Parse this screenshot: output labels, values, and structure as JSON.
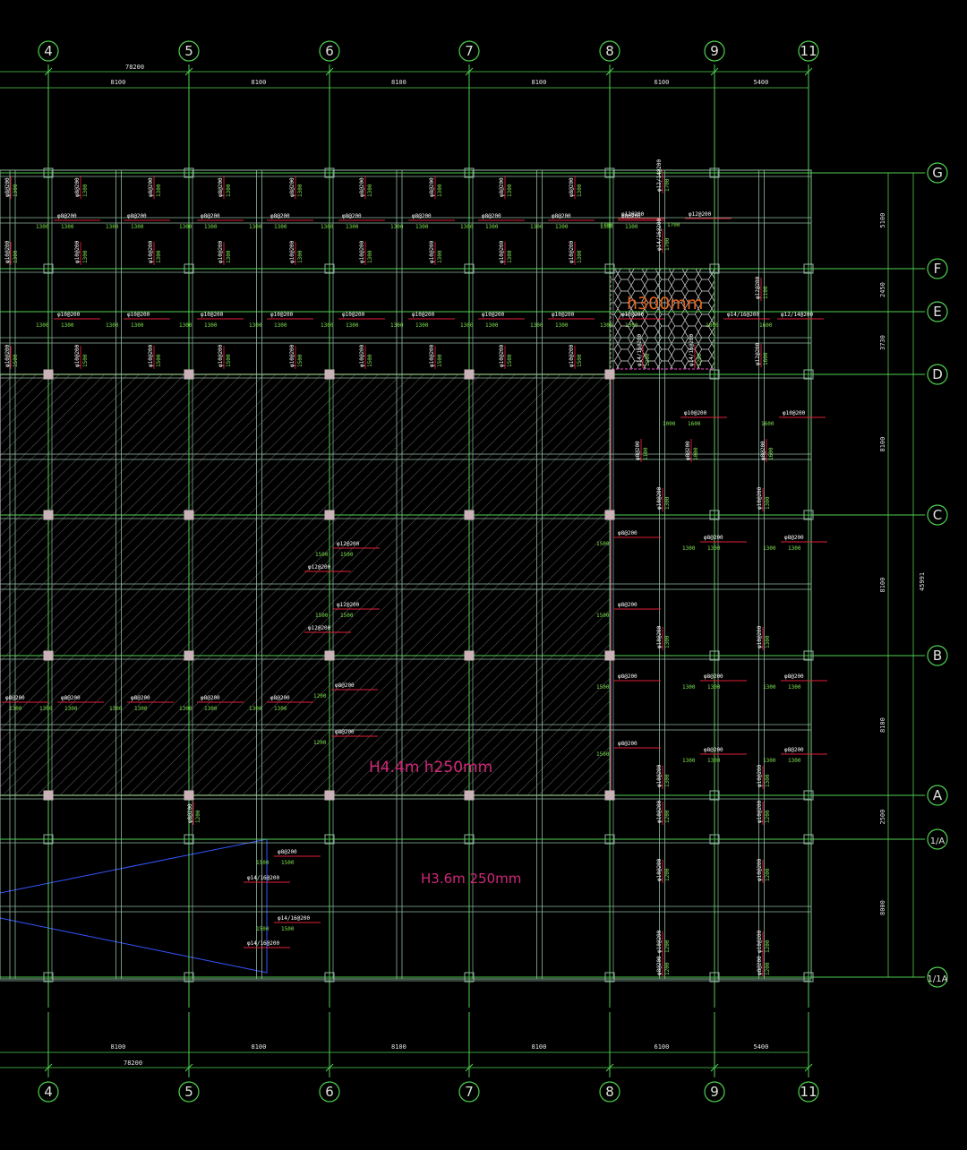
{
  "drawing": {
    "column_axes": [
      "4",
      "5",
      "6",
      "7",
      "8",
      "9",
      "11"
    ],
    "row_axes": [
      "G",
      "F",
      "E",
      "D",
      "C",
      "B",
      "A",
      "1/A",
      "1/1A"
    ],
    "top_total_dim": "78200",
    "bottom_total_dim": "78200",
    "top_span_dims": [
      "8100",
      "8100",
      "8100",
      "8100",
      "6100",
      "5400"
    ],
    "bottom_span_dims": [
      "8100",
      "8100",
      "8100",
      "8100",
      "6100",
      "5400"
    ],
    "right_span_dims": [
      "5100",
      "2450",
      "3730",
      "8100",
      "8100",
      "8100",
      "2500",
      "8000"
    ],
    "right_total_dim": "45991",
    "zone_labels": {
      "thick_slab": "h300mm",
      "hatched_slab": "H4.4m h250mm",
      "lower_slab": "H3.6m 250mm"
    },
    "rebar_labels": {
      "a": "φ8@200",
      "b": "φ10@200",
      "c": "φ12@200",
      "d": "φ14/16@200",
      "e": "φ12/14@200"
    },
    "rebar_lengths": [
      "1300",
      "1500",
      "1600",
      "1700",
      "1000",
      "1100",
      "1200",
      "1800"
    ],
    "colors": {
      "background": "#000000",
      "grid": "#4fd04f",
      "beam": "#8fb8a0",
      "hatch": "#6a6a6a",
      "boundary": "#c23fa3",
      "rebar_red": "#e0203a",
      "zone_text": "#d1287a",
      "thick_slab_text": "#e0621c",
      "blue_line": "#3355ff",
      "column": "#c9b3b8"
    }
  }
}
